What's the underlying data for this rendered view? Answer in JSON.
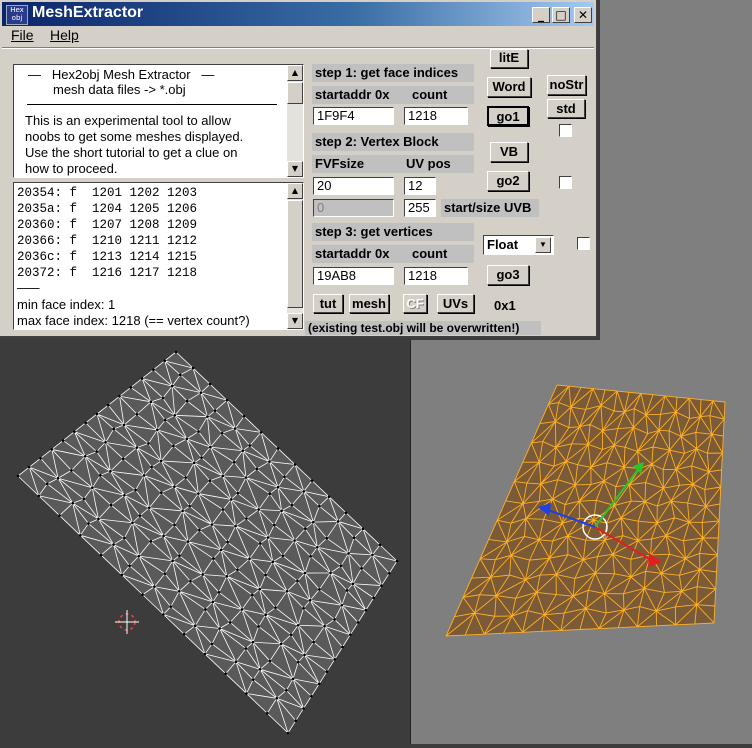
{
  "window": {
    "title": "MeshExtractor",
    "icon_text_top": "Hex",
    "icon_text_bottom": "obj",
    "minimize": "_",
    "maximize": "□",
    "close": "✕"
  },
  "menu": {
    "file": "File",
    "help": "Help"
  },
  "info": {
    "line1": "—   Hex2obj Mesh Extractor   —",
    "line2": "mesh data files -> *.obj",
    "line3": "This is an experimental tool to allow",
    "line4": "noobs to get some meshes displayed.",
    "line5": "Use the short tutorial to get a clue on",
    "line6": "how to proceed."
  },
  "log": {
    "lines": [
      "20354: f  1201 1202 1203",
      "2035a: f  1204 1205 1206",
      "20360: f  1207 1208 1209",
      "20366: f  1210 1211 1212",
      "2036c: f  1213 1214 1215",
      "20372: f  1216 1217 1218"
    ],
    "rule": "———",
    "min": "min face index: 1",
    "max": "max face index: 1218 (== vertex count?)"
  },
  "step1": {
    "title": "step 1: get face indices",
    "addr_label": "startaddr 0x",
    "count_label": "count",
    "addr": "1F9F4",
    "count": "1218"
  },
  "step2": {
    "title": "step 2: Vertex Block",
    "fvf_label": "FVFsize",
    "uv_label": "UV pos",
    "fvf": "20",
    "uv": "12",
    "uvb_start": "0",
    "uvb_size": "255",
    "uvb_label": "start/size UVB"
  },
  "step3": {
    "title": "step 3: get vertices",
    "addr_label": "startaddr 0x",
    "count_label": "count",
    "addr": "19AB8",
    "count": "1218",
    "type": "Float"
  },
  "buttons": {
    "lite": "litE",
    "word": "Word",
    "go1": "go1",
    "nostr": "noStr",
    "std": "std",
    "vb": "VB",
    "go2": "go2",
    "go3": "go3",
    "zerox1": "0x1",
    "tut": "tut",
    "mesh": "mesh",
    "cf": "CF",
    "uvs": "UVs"
  },
  "footer_note": "(existing test.obj will be overwritten!)"
}
